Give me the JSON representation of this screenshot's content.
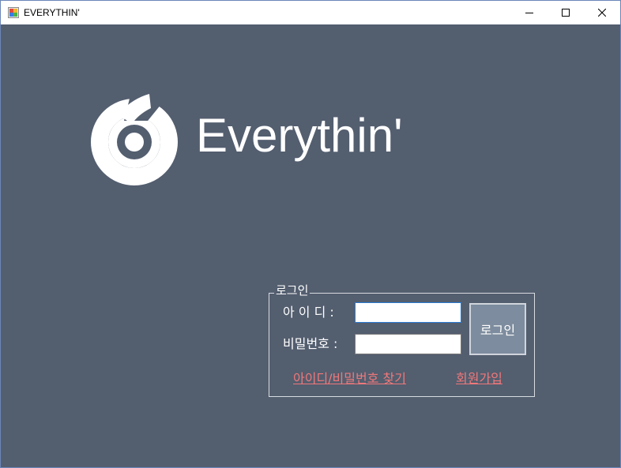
{
  "window": {
    "title": "EVERYTHIN'",
    "controls": [
      "minimize-icon",
      "maximize-icon",
      "close-icon"
    ]
  },
  "logo": {
    "icon": "everythin-logo-icon",
    "text": "Everythin'"
  },
  "login_group": {
    "title": "로그인",
    "id_label": "아 이 디 :",
    "id_value": "",
    "password_label": "비밀번호 :",
    "password_value": "",
    "login_button": "로그인",
    "find_link": "아이디/비밀번호 찾기",
    "signup_link": "회원가입"
  },
  "colors": {
    "background": "#535e6f",
    "link": "#f0787a",
    "button": "#7d8c9e"
  }
}
